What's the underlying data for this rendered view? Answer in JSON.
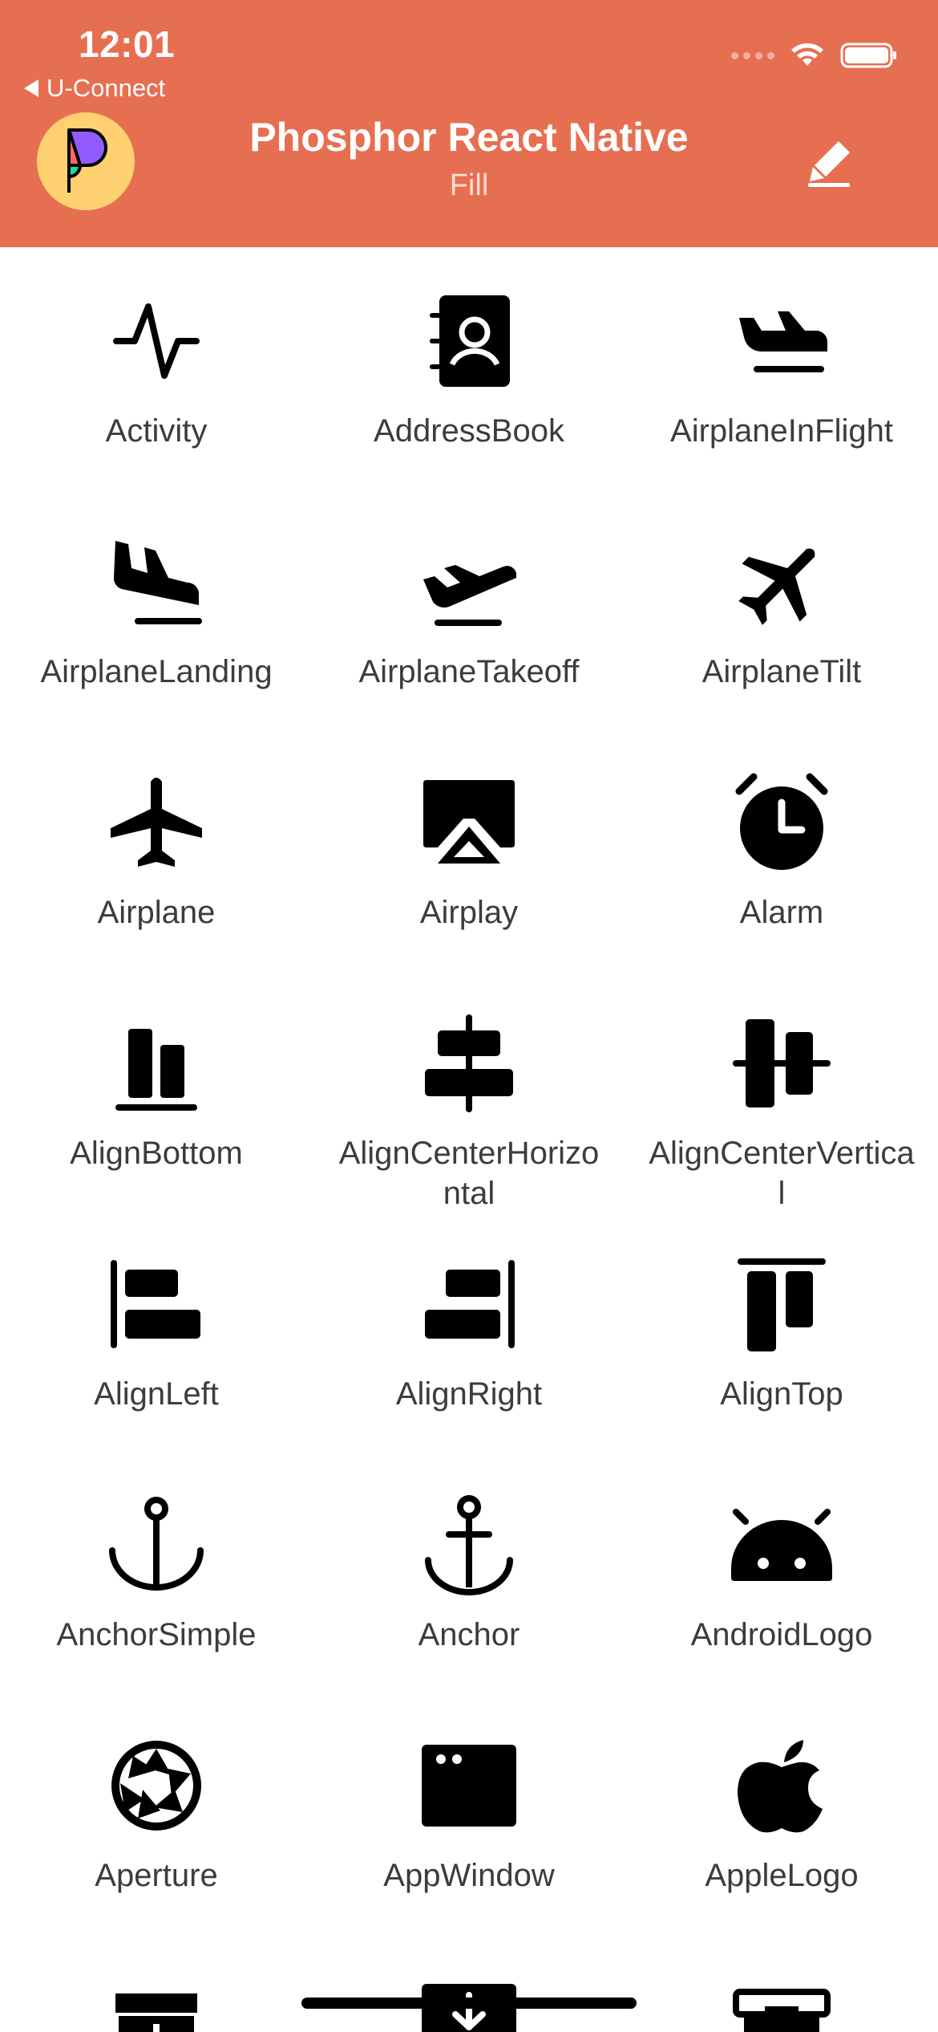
{
  "status_bar": {
    "time": "12:01",
    "back_label": "U-Connect"
  },
  "header": {
    "title": "Phosphor React Native",
    "subtitle": "Fill"
  },
  "colors": {
    "header_bg": "#E76F51",
    "logo_bg": "#FFD171",
    "icon": "#000000",
    "label": "#3c3c3c"
  },
  "icons": [
    {
      "name": "activity-icon",
      "label": "Activity"
    },
    {
      "name": "address-book-icon",
      "label": "AddressBook"
    },
    {
      "name": "airplane-in-flight-icon",
      "label": "AirplaneInFlight"
    },
    {
      "name": "airplane-landing-icon",
      "label": "AirplaneLanding"
    },
    {
      "name": "airplane-takeoff-icon",
      "label": "AirplaneTakeoff"
    },
    {
      "name": "airplane-tilt-icon",
      "label": "AirplaneTilt"
    },
    {
      "name": "airplane-icon",
      "label": "Airplane"
    },
    {
      "name": "airplay-icon",
      "label": "Airplay"
    },
    {
      "name": "alarm-icon",
      "label": "Alarm"
    },
    {
      "name": "align-bottom-icon",
      "label": "AlignBottom"
    },
    {
      "name": "align-center-horizontal-icon",
      "label": "AlignCenterHorizontal"
    },
    {
      "name": "align-center-vertical-icon",
      "label": "AlignCenterVertical"
    },
    {
      "name": "align-left-icon",
      "label": "AlignLeft"
    },
    {
      "name": "align-right-icon",
      "label": "AlignRight"
    },
    {
      "name": "align-top-icon",
      "label": "AlignTop"
    },
    {
      "name": "anchor-simple-icon",
      "label": "AnchorSimple"
    },
    {
      "name": "anchor-icon",
      "label": "Anchor"
    },
    {
      "name": "android-logo-icon",
      "label": "AndroidLogo"
    },
    {
      "name": "aperture-icon",
      "label": "Aperture"
    },
    {
      "name": "app-window-icon",
      "label": "AppWindow"
    },
    {
      "name": "apple-logo-icon",
      "label": "AppleLogo"
    }
  ],
  "partial_row_icons": [
    "archive-box-icon",
    "archive-tray-icon",
    "archive-icon"
  ]
}
